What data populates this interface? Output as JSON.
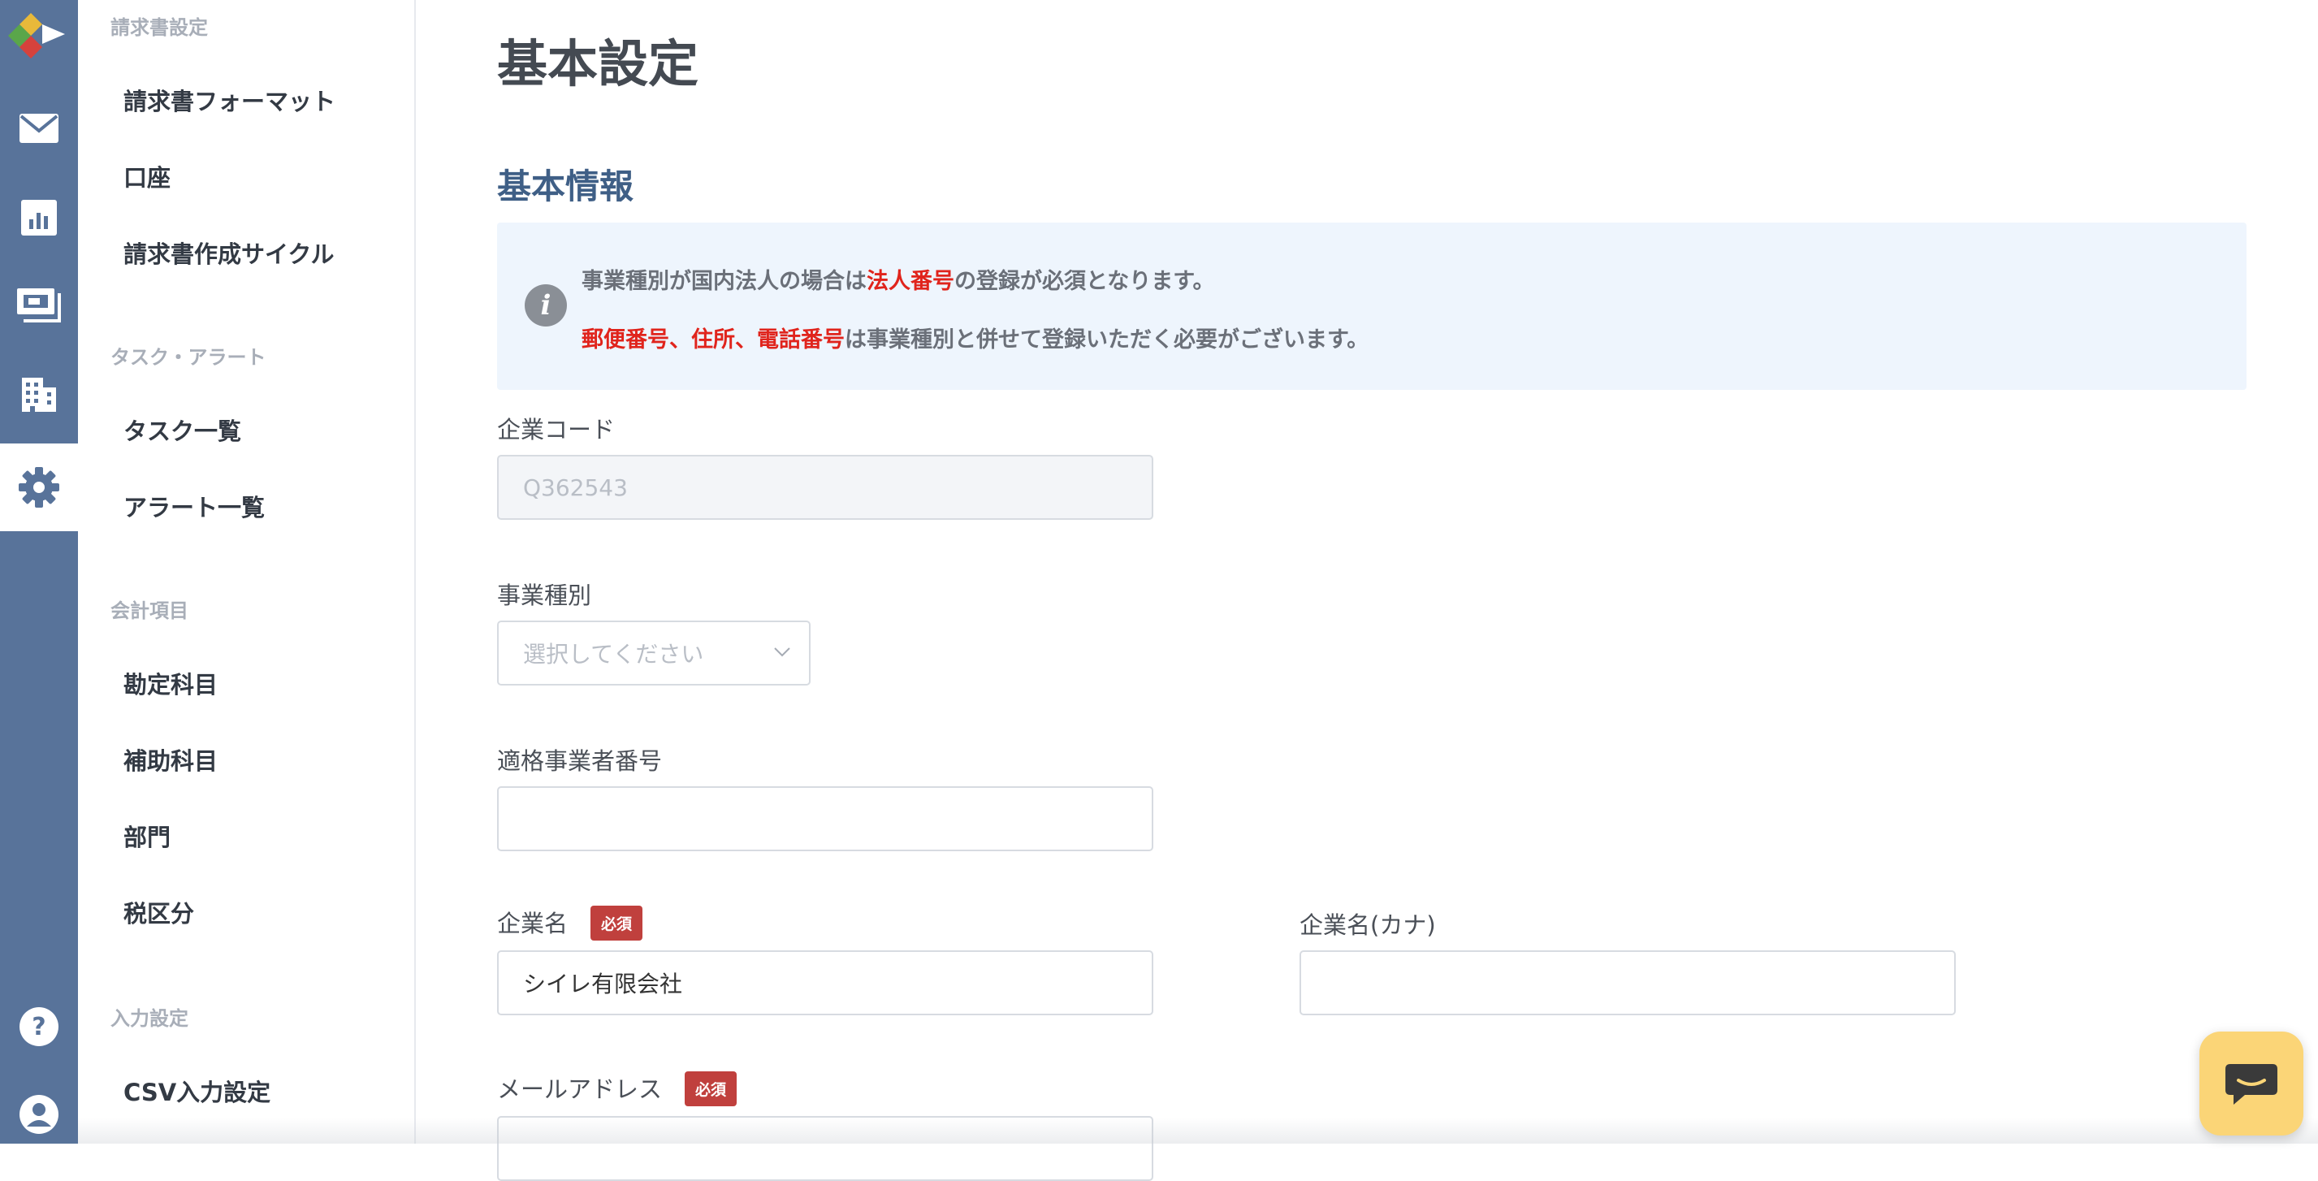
{
  "rail": {
    "items": [
      {
        "name": "mail-icon"
      },
      {
        "name": "chart-icon"
      },
      {
        "name": "payment-icon"
      },
      {
        "name": "building-icon"
      },
      {
        "name": "gear-icon",
        "active": true
      },
      {
        "name": "help-icon"
      },
      {
        "name": "user-icon"
      }
    ]
  },
  "sidebar": {
    "sections": [
      {
        "heading": "請求書設定",
        "items": [
          "請求書フォーマット",
          "口座",
          "請求書作成サイクル"
        ]
      },
      {
        "heading": "タスク・アラート",
        "items": [
          "タスク一覧",
          "アラート一覧"
        ]
      },
      {
        "heading": "会計項目",
        "items": [
          "勘定科目",
          "補助科目",
          "部門",
          "税区分"
        ]
      },
      {
        "heading": "入力設定",
        "items": [
          "CSV入力設定"
        ]
      }
    ]
  },
  "main": {
    "page_title": "基本設定",
    "section_title": "基本情報",
    "info": {
      "line1_a": "事業種別が国内法人の場合は",
      "line1_red": "法人番号",
      "line1_b": "の登録が必須となります。",
      "line2_red": "郵便番号、住所、電話番号",
      "line2_b": "は事業種別と併せて登録いただく必要がございます。"
    },
    "fields": {
      "company_code": {
        "label": "企業コード",
        "value": "Q362543"
      },
      "business_type": {
        "label": "事業種別",
        "placeholder": "選択してください"
      },
      "invoice_number": {
        "label": "適格事業者番号",
        "value": ""
      },
      "company_name": {
        "label": "企業名",
        "value": "シイレ有限会社"
      },
      "company_name_kana": {
        "label": "企業名(カナ)",
        "value": ""
      },
      "email": {
        "label": "メールアドレス",
        "value": ""
      }
    },
    "required_badge": "必須"
  },
  "colors": {
    "rail": "#58739a",
    "heading_blue": "#3f5f86",
    "required_red": "#c0403d",
    "info_red": "#e0241c",
    "info_bg": "#eef5fd",
    "chat_yellow": "#fbd577"
  }
}
